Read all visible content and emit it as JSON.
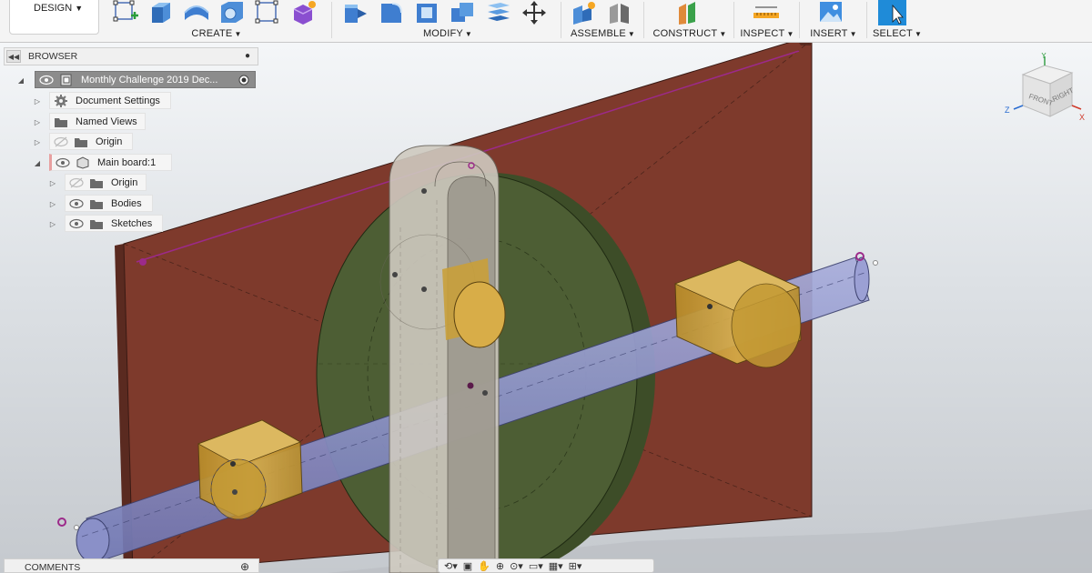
{
  "toolbar": {
    "design_label": "DESIGN",
    "groups": [
      {
        "label": "CREATE"
      },
      {
        "label": "MODIFY"
      },
      {
        "label": "ASSEMBLE"
      },
      {
        "label": "CONSTRUCT"
      },
      {
        "label": "INSPECT"
      },
      {
        "label": "INSERT"
      },
      {
        "label": "SELECT"
      }
    ]
  },
  "browser": {
    "title": "BROWSER",
    "root": "Monthly Challenge 2019 Dec...",
    "items": [
      {
        "label": "Document Settings"
      },
      {
        "label": "Named Views"
      },
      {
        "label": "Origin"
      },
      {
        "label": "Main board:1"
      },
      {
        "label": "Origin"
      },
      {
        "label": "Bodies"
      },
      {
        "label": "Sketches"
      }
    ]
  },
  "comments": {
    "title": "COMMENTS"
  },
  "viewcube": {
    "front": "FRONT",
    "right": "RIGHT",
    "axis_y": "Y",
    "axis_z": "Z",
    "axis_x": "X"
  },
  "colors": {
    "board": "#7e3a2c",
    "disc": "#4d5e34",
    "shaft": "#8d93c9",
    "bearing": "#c9a03a",
    "slider": "#cfcac0",
    "sketch": "#9c2a8a"
  }
}
